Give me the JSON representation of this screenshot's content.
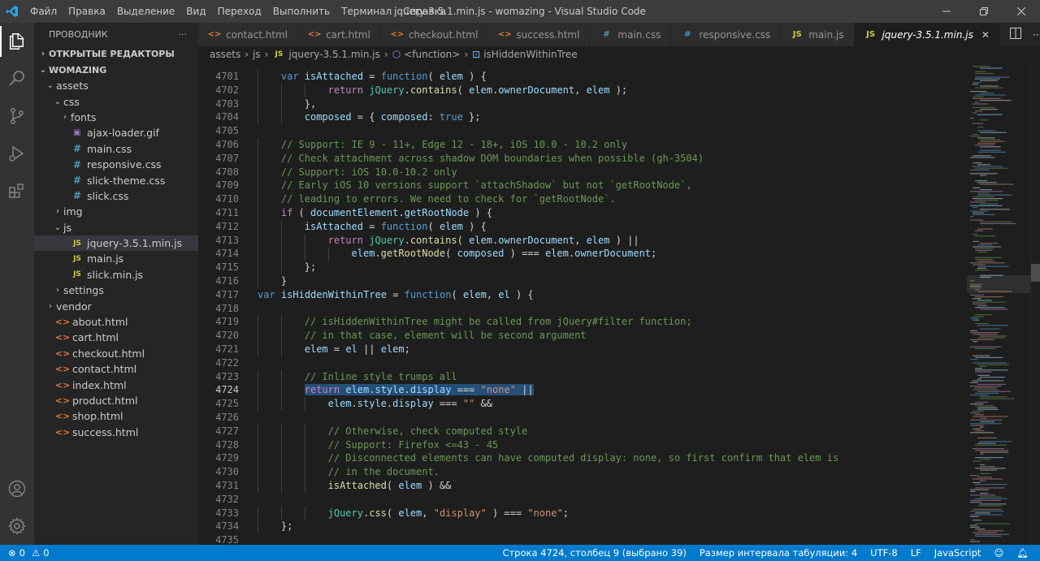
{
  "window": {
    "title": "jquery-3.5.1.min.js - womazing - Visual Studio Code",
    "menu": [
      "Файл",
      "Правка",
      "Выделение",
      "Вид",
      "Переход",
      "Выполнить",
      "Терминал",
      "Справка"
    ]
  },
  "sidebar": {
    "header": "ПРОВОДНИК",
    "more": "···",
    "open_editors": "ОТКРЫТЫЕ РЕДАКТОРЫ",
    "project": "WOMAZING",
    "tree": [
      {
        "label": "assets",
        "type": "folder",
        "depth": 1,
        "open": true
      },
      {
        "label": "css",
        "type": "folder",
        "depth": 2,
        "open": true
      },
      {
        "label": "fonts",
        "type": "folder",
        "depth": 3,
        "open": false
      },
      {
        "label": "ajax-loader.gif",
        "type": "gif",
        "depth": 3
      },
      {
        "label": "main.css",
        "type": "css",
        "depth": 3
      },
      {
        "label": "responsive.css",
        "type": "css",
        "depth": 3
      },
      {
        "label": "slick-theme.css",
        "type": "css",
        "depth": 3
      },
      {
        "label": "slick.css",
        "type": "css",
        "depth": 3
      },
      {
        "label": "img",
        "type": "folder",
        "depth": 2,
        "open": false
      },
      {
        "label": "js",
        "type": "folder",
        "depth": 2,
        "open": true
      },
      {
        "label": "jquery-3.5.1.min.js",
        "type": "js",
        "depth": 3,
        "selected": true
      },
      {
        "label": "main.js",
        "type": "js",
        "depth": 3
      },
      {
        "label": "slick.min.js",
        "type": "js",
        "depth": 3
      },
      {
        "label": "settings",
        "type": "folder",
        "depth": 2,
        "open": false
      },
      {
        "label": "vendor",
        "type": "folder",
        "depth": 1,
        "open": false
      },
      {
        "label": "about.html",
        "type": "html",
        "depth": 1
      },
      {
        "label": "cart.html",
        "type": "html",
        "depth": 1
      },
      {
        "label": "checkout.html",
        "type": "html",
        "depth": 1
      },
      {
        "label": "contact.html",
        "type": "html",
        "depth": 1
      },
      {
        "label": "index.html",
        "type": "html",
        "depth": 1
      },
      {
        "label": "product.html",
        "type": "html",
        "depth": 1
      },
      {
        "label": "shop.html",
        "type": "html",
        "depth": 1
      },
      {
        "label": "success.html",
        "type": "html",
        "depth": 1
      }
    ]
  },
  "tabs": [
    {
      "label": "contact.html",
      "type": "html"
    },
    {
      "label": "cart.html",
      "type": "html"
    },
    {
      "label": "checkout.html",
      "type": "html"
    },
    {
      "label": "success.html",
      "type": "html"
    },
    {
      "label": "main.css",
      "type": "css"
    },
    {
      "label": "responsive.css",
      "type": "css"
    },
    {
      "label": "main.js",
      "type": "js"
    },
    {
      "label": "jquery-3.5.1.min.js",
      "type": "js",
      "active": true
    }
  ],
  "breadcrumb": [
    "assets",
    "js",
    "jquery-3.5.1.min.js",
    "<function>",
    "isHiddenWithinTree"
  ],
  "editor": {
    "first_line": 4700,
    "current_line": 4724,
    "lines": [
      {
        "n": 4701,
        "indent": 1,
        "tokens": [
          [
            "kw",
            "var"
          ],
          [
            "pun",
            " "
          ],
          [
            "vr",
            "isAttached"
          ],
          [
            "pun",
            " = "
          ],
          [
            "kw",
            "function"
          ],
          [
            "pun",
            "( "
          ],
          [
            "vr",
            "elem"
          ],
          [
            "pun",
            " ) {"
          ]
        ]
      },
      {
        "n": 4702,
        "indent": 3,
        "tokens": [
          [
            "ctl",
            "return"
          ],
          [
            "pun",
            " "
          ],
          [
            "cls",
            "jQuery"
          ],
          [
            "pun",
            "."
          ],
          [
            "fn",
            "contains"
          ],
          [
            "pun",
            "( "
          ],
          [
            "vr",
            "elem"
          ],
          [
            "pun",
            "."
          ],
          [
            "vr",
            "ownerDocument"
          ],
          [
            "pun",
            ", "
          ],
          [
            "vr",
            "elem"
          ],
          [
            "pun",
            " );"
          ]
        ]
      },
      {
        "n": 4703,
        "indent": 2,
        "tokens": [
          [
            "pun",
            "},"
          ]
        ]
      },
      {
        "n": 4704,
        "indent": 2,
        "tokens": [
          [
            "vr",
            "composed"
          ],
          [
            "pun",
            " = { "
          ],
          [
            "vr",
            "composed"
          ],
          [
            "pun",
            ": "
          ],
          [
            "kw",
            "true"
          ],
          [
            "pun",
            " };"
          ]
        ]
      },
      {
        "n": 4705,
        "indent": 0,
        "tokens": []
      },
      {
        "n": 4706,
        "indent": 1,
        "tokens": [
          [
            "cmt",
            "// Support: IE 9 - 11+, Edge 12 - 18+, iOS 10.0 - 10.2 only"
          ]
        ]
      },
      {
        "n": 4707,
        "indent": 1,
        "tokens": [
          [
            "cmt",
            "// Check attachment across shadow DOM boundaries when possible (gh-3504)"
          ]
        ]
      },
      {
        "n": 4708,
        "indent": 1,
        "tokens": [
          [
            "cmt",
            "// Support: iOS 10.0-10.2 only"
          ]
        ]
      },
      {
        "n": 4709,
        "indent": 1,
        "tokens": [
          [
            "cmt",
            "// Early iOS 10 versions support `attachShadow` but not `getRootNode`,"
          ]
        ]
      },
      {
        "n": 4710,
        "indent": 1,
        "tokens": [
          [
            "cmt",
            "// leading to errors. We need to check for `getRootNode`."
          ]
        ]
      },
      {
        "n": 4711,
        "indent": 1,
        "tokens": [
          [
            "ctl",
            "if"
          ],
          [
            "pun",
            " ( "
          ],
          [
            "vr",
            "documentElement"
          ],
          [
            "pun",
            "."
          ],
          [
            "vr",
            "getRootNode"
          ],
          [
            "pun",
            " ) {"
          ]
        ]
      },
      {
        "n": 4712,
        "indent": 2,
        "tokens": [
          [
            "vr",
            "isAttached"
          ],
          [
            "pun",
            " = "
          ],
          [
            "kw",
            "function"
          ],
          [
            "pun",
            "( "
          ],
          [
            "vr",
            "elem"
          ],
          [
            "pun",
            " ) {"
          ]
        ]
      },
      {
        "n": 4713,
        "indent": 3,
        "tokens": [
          [
            "ctl",
            "return"
          ],
          [
            "pun",
            " "
          ],
          [
            "cls",
            "jQuery"
          ],
          [
            "pun",
            "."
          ],
          [
            "fn",
            "contains"
          ],
          [
            "pun",
            "( "
          ],
          [
            "vr",
            "elem"
          ],
          [
            "pun",
            "."
          ],
          [
            "vr",
            "ownerDocument"
          ],
          [
            "pun",
            ", "
          ],
          [
            "vr",
            "elem"
          ],
          [
            "pun",
            " ) ||"
          ]
        ]
      },
      {
        "n": 4714,
        "indent": 4,
        "tokens": [
          [
            "vr",
            "elem"
          ],
          [
            "pun",
            "."
          ],
          [
            "fn",
            "getRootNode"
          ],
          [
            "pun",
            "( "
          ],
          [
            "vr",
            "composed"
          ],
          [
            "pun",
            " ) === "
          ],
          [
            "vr",
            "elem"
          ],
          [
            "pun",
            "."
          ],
          [
            "vr",
            "ownerDocument"
          ],
          [
            "pun",
            ";"
          ]
        ]
      },
      {
        "n": 4715,
        "indent": 2,
        "tokens": [
          [
            "pun",
            "};"
          ]
        ]
      },
      {
        "n": 4716,
        "indent": 1,
        "tokens": [
          [
            "pun",
            "}"
          ]
        ]
      },
      {
        "n": 4717,
        "indent": 0,
        "tokens": [
          [
            "kw",
            "var"
          ],
          [
            "pun",
            " "
          ],
          [
            "vr",
            "isHiddenWithinTree"
          ],
          [
            "pun",
            " = "
          ],
          [
            "kw",
            "function"
          ],
          [
            "pun",
            "( "
          ],
          [
            "vr",
            "elem"
          ],
          [
            "pun",
            ", "
          ],
          [
            "vr",
            "el"
          ],
          [
            "pun",
            " ) {"
          ]
        ]
      },
      {
        "n": 4718,
        "indent": 0,
        "tokens": []
      },
      {
        "n": 4719,
        "indent": 2,
        "tokens": [
          [
            "cmt",
            "// isHiddenWithinTree might be called from jQuery#filter function;"
          ]
        ]
      },
      {
        "n": 4720,
        "indent": 2,
        "tokens": [
          [
            "cmt",
            "// in that case, element will be second argument"
          ]
        ]
      },
      {
        "n": 4721,
        "indent": 2,
        "tokens": [
          [
            "vr",
            "elem"
          ],
          [
            "pun",
            " = "
          ],
          [
            "vr",
            "el"
          ],
          [
            "pun",
            " || "
          ],
          [
            "vr",
            "elem"
          ],
          [
            "pun",
            ";"
          ]
        ]
      },
      {
        "n": 4722,
        "indent": 0,
        "tokens": []
      },
      {
        "n": 4723,
        "indent": 2,
        "tokens": [
          [
            "cmt",
            "// Inline style trumps all"
          ]
        ]
      },
      {
        "n": 4724,
        "indent": 2,
        "selected": true,
        "tokens": [
          [
            "ctl",
            "return"
          ],
          [
            "pun",
            " "
          ],
          [
            "vr",
            "elem"
          ],
          [
            "pun",
            "."
          ],
          [
            "vr",
            "style"
          ],
          [
            "pun",
            "."
          ],
          [
            "vr",
            "display"
          ],
          [
            "pun",
            " === "
          ],
          [
            "str",
            "\"none\""
          ],
          [
            "pun",
            " ||"
          ]
        ]
      },
      {
        "n": 4725,
        "indent": 3,
        "tokens": [
          [
            "vr",
            "elem"
          ],
          [
            "pun",
            "."
          ],
          [
            "vr",
            "style"
          ],
          [
            "pun",
            "."
          ],
          [
            "vr",
            "display"
          ],
          [
            "pun",
            " === "
          ],
          [
            "str",
            "\"\""
          ],
          [
            "pun",
            " &&"
          ]
        ]
      },
      {
        "n": 4726,
        "indent": 0,
        "tokens": []
      },
      {
        "n": 4727,
        "indent": 3,
        "tokens": [
          [
            "cmt",
            "// Otherwise, check computed style"
          ]
        ]
      },
      {
        "n": 4728,
        "indent": 3,
        "tokens": [
          [
            "cmt",
            "// Support: Firefox <=43 - 45"
          ]
        ]
      },
      {
        "n": 4729,
        "indent": 3,
        "tokens": [
          [
            "cmt",
            "// Disconnected elements can have computed display: none, so first confirm that elem is"
          ]
        ]
      },
      {
        "n": 4730,
        "indent": 3,
        "tokens": [
          [
            "cmt",
            "// in the document."
          ]
        ]
      },
      {
        "n": 4731,
        "indent": 3,
        "tokens": [
          [
            "fn",
            "isAttached"
          ],
          [
            "pun",
            "( "
          ],
          [
            "vr",
            "elem"
          ],
          [
            "pun",
            " ) &&"
          ]
        ]
      },
      {
        "n": 4732,
        "indent": 0,
        "tokens": []
      },
      {
        "n": 4733,
        "indent": 3,
        "tokens": [
          [
            "cls",
            "jQuery"
          ],
          [
            "pun",
            "."
          ],
          [
            "fn",
            "css"
          ],
          [
            "pun",
            "( "
          ],
          [
            "vr",
            "elem"
          ],
          [
            "pun",
            ", "
          ],
          [
            "str",
            "\"display\""
          ],
          [
            "pun",
            " ) === "
          ],
          [
            "str",
            "\"none\""
          ],
          [
            "pun",
            ";"
          ]
        ]
      },
      {
        "n": 4734,
        "indent": 1,
        "tokens": [
          [
            "pun",
            "};"
          ]
        ]
      },
      {
        "n": 4735,
        "indent": 0,
        "tokens": []
      }
    ]
  },
  "status": {
    "errors": "0",
    "warnings": "0",
    "position": "Строка 4724, столбец 9 (выбрано 39)",
    "indent": "Размер интервала табуляции: 4",
    "encoding": "UTF-8",
    "eol": "LF",
    "language": "JavaScript"
  },
  "colors": {
    "accent": "#007acc",
    "selection": "#264f78"
  }
}
